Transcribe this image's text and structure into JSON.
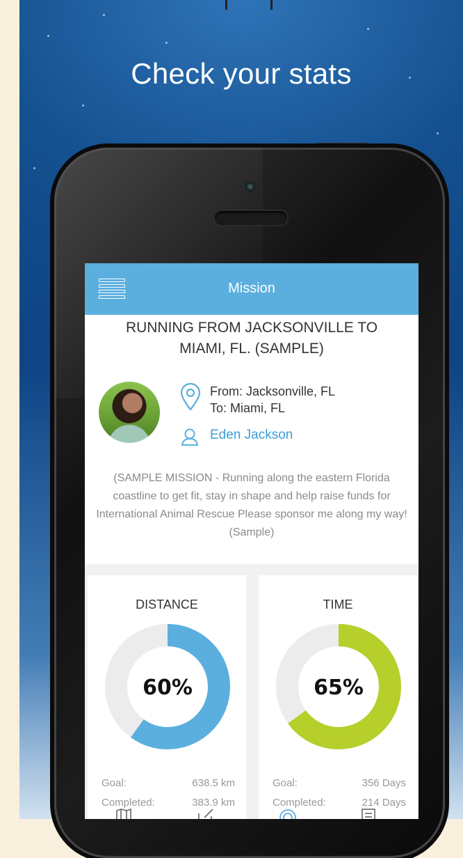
{
  "headline": "Check your stats",
  "navbar": {
    "title": "Mission"
  },
  "mission": {
    "title": "RUNNING FROM JACKSONVILLE TO MIAMI, FL. (SAMPLE)",
    "from": "From: Jacksonville, FL",
    "to": "To: Miami, FL",
    "owner": "Eden Jackson",
    "description": "(SAMPLE MISSION - Running along the eastern Florida coastline to get fit, stay in shape and help raise funds for International Animal Rescue Please sponsor me along my way! (Sample)"
  },
  "stats": {
    "distance": {
      "label": "DISTANCE",
      "percent_text": "60%",
      "percent": 0.6,
      "goal_label": "Goal:",
      "goal_value": "638.5 km",
      "completed_label": "Completed:",
      "completed_value": "383.9 km",
      "color": "#5aafde"
    },
    "time": {
      "label": "TIME",
      "percent_text": "65%",
      "percent": 0.65,
      "goal_label": "Goal:",
      "goal_value": "356 Days",
      "completed_label": "Completed:",
      "completed_value": "214 Days",
      "color": "#b6cf2b"
    }
  },
  "tabbar": {
    "icons": [
      "map-icon",
      "edit-icon",
      "target-icon",
      "list-icon"
    ]
  },
  "colors": {
    "accent": "#5aafde",
    "ring_track": "#ececec"
  }
}
